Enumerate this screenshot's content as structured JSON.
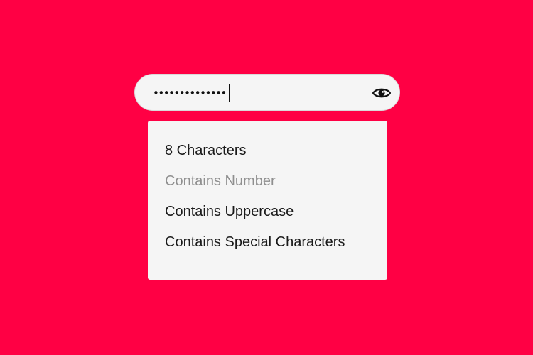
{
  "colors": {
    "background": "#ff0044",
    "panel": "#f5f5f5",
    "met_text": "#1a1a1a",
    "unmet_text": "#8f8f8f"
  },
  "password_field": {
    "masked_value": "••••••••••••••",
    "toggle_icon": "eye-icon"
  },
  "requirements": [
    {
      "label": "8 Characters",
      "met": true
    },
    {
      "label": "Contains Number",
      "met": false
    },
    {
      "label": "Contains Uppercase",
      "met": true
    },
    {
      "label": "Contains Special Characters",
      "met": true
    }
  ]
}
